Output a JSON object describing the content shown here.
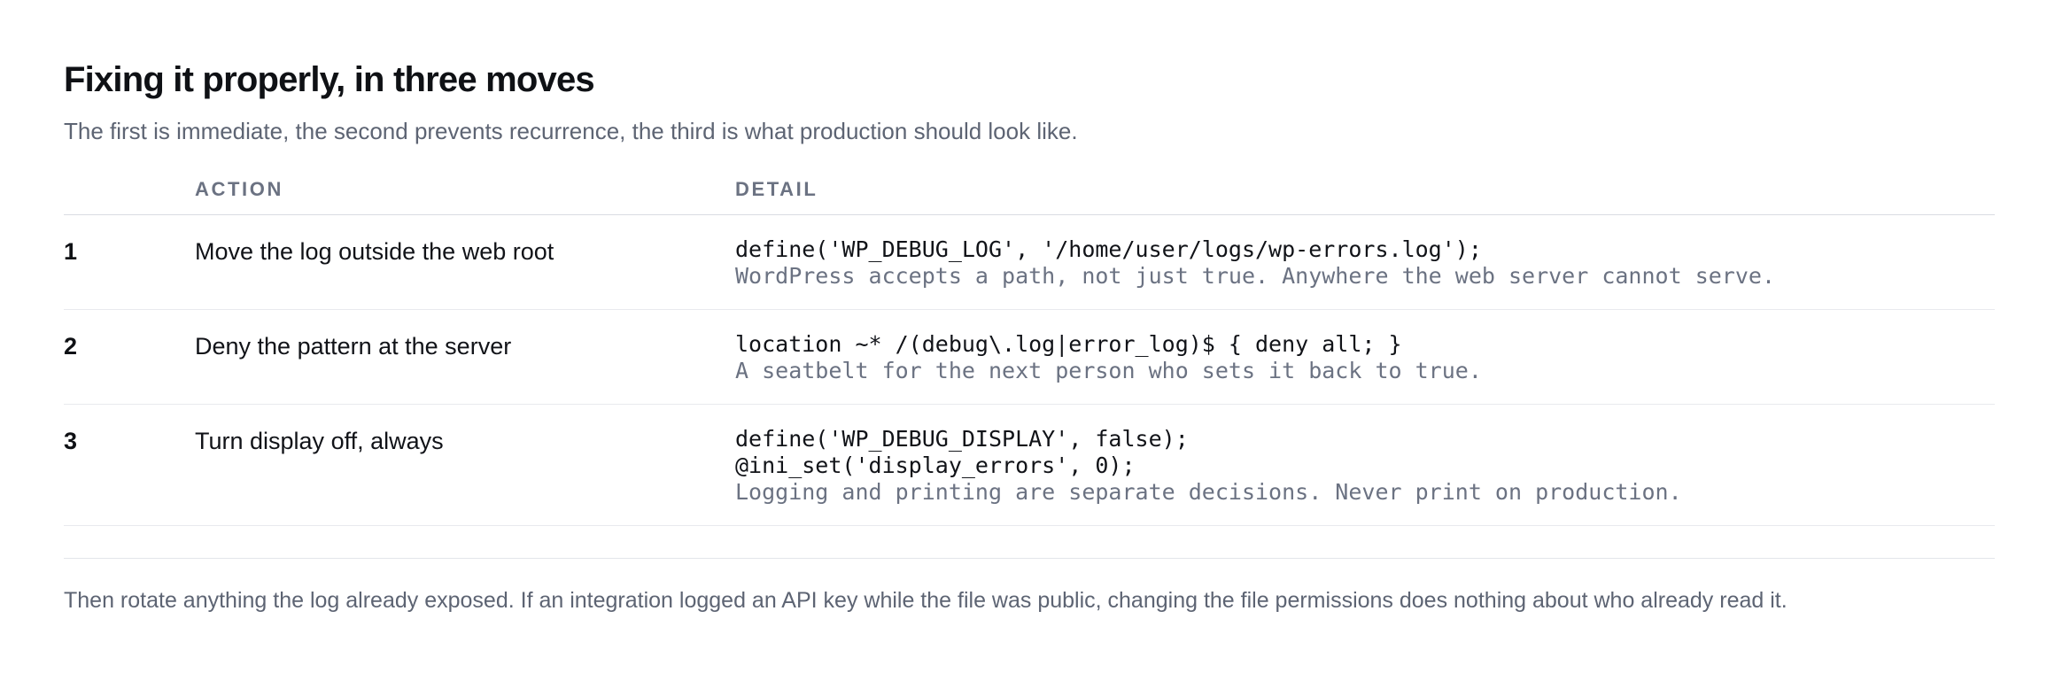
{
  "section": {
    "title": "Fixing it properly, in three moves",
    "subtitle": "The first is immediate, the second prevents recurrence, the third is what production should look like."
  },
  "table": {
    "headers": {
      "number": "",
      "action": "ACTION",
      "detail": "DETAIL"
    },
    "rows": [
      {
        "number": "1",
        "action": "Move the log outside the web root",
        "code": [
          "define('WP_DEBUG_LOG', '/home/user/logs/wp-errors.log');"
        ],
        "note": "WordPress accepts a path, not just true. Anywhere the web server cannot serve."
      },
      {
        "number": "2",
        "action": "Deny the pattern at the server",
        "code": [
          "location ~* /(debug\\.log|error_log)$ { deny all; }"
        ],
        "note": "A seatbelt for the next person who sets it back to true."
      },
      {
        "number": "3",
        "action": "Turn display off, always",
        "code": [
          "define('WP_DEBUG_DISPLAY', false);",
          "@ini_set('display_errors', 0);"
        ],
        "note": "Logging and printing are separate decisions. Never print on production."
      }
    ]
  },
  "footer": {
    "text": "Then rotate anything the log already exposed. If an integration logged an API key while the file was public, changing the file permissions does nothing about who already read it."
  }
}
